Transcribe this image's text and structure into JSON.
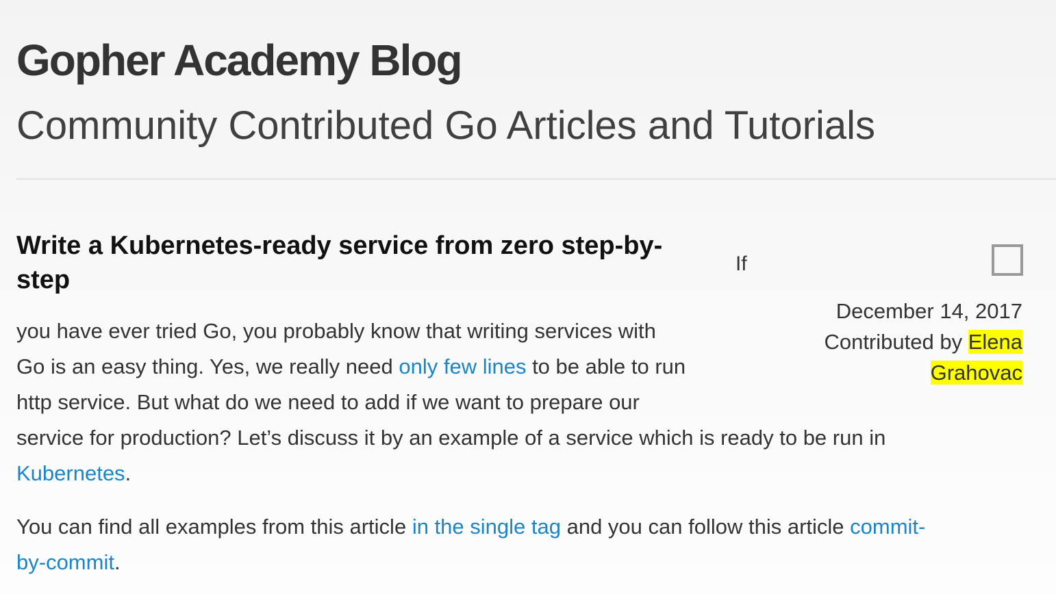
{
  "site": {
    "title": "Gopher Academy Blog",
    "subtitle": "Community Contributed Go Articles and Tutorials"
  },
  "post": {
    "title": "Write a Kubernetes-ready service from zero step-by-step",
    "title_line1": "Write a Kubernetes-ready service from zero step-by-",
    "title_line2": "step",
    "float_word": "If",
    "date": "December 14, 2017",
    "contributed_by": "Contributed by",
    "author_first": "Elena",
    "author_last": "Grahovac",
    "para1": {
      "l1": "you have ever tried Go, you probably know that writing services with",
      "l2a": "Go is an easy thing. Yes, we really need ",
      "link1": "only few lines",
      "l2b": " to be able to run",
      "l3": "http service. But what do we need to add if we want to prepare our",
      "l4": "service for production? Let’s discuss it by an example of a service which is ready to be run in",
      "link2": "Kubernetes",
      "end": "."
    },
    "para2": {
      "a": "You can find all examples from this article ",
      "link1": "in the single tag",
      "b": " and you can follow this article ",
      "link2a": "commit-",
      "link2b": "by-commit",
      "end": "."
    }
  },
  "colors": {
    "link": "#1a85c8",
    "highlight": "#ffff00",
    "text": "#333333"
  }
}
